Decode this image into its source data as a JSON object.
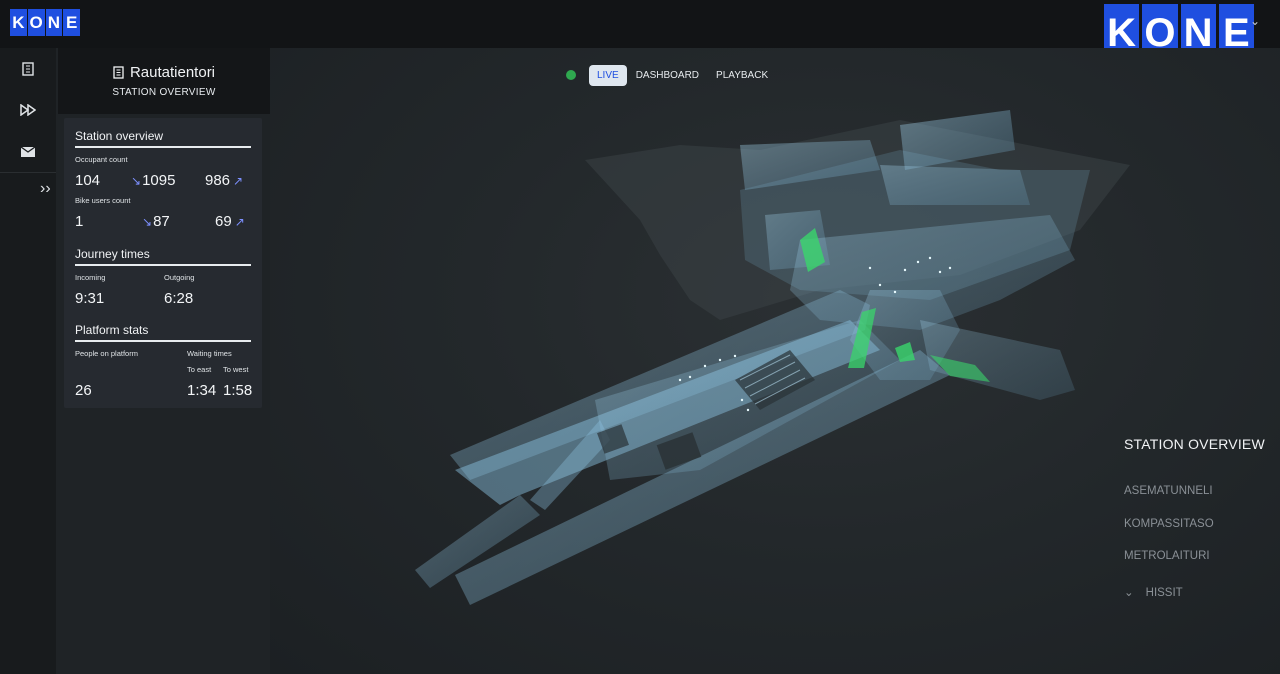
{
  "brand": {
    "logo_letters": [
      "K",
      "O",
      "N",
      "E"
    ]
  },
  "station": {
    "name": "Rautatientori",
    "subtitle": "STATION OVERVIEW"
  },
  "modes": {
    "live": "LIVE",
    "dashboard": "DASHBOARD",
    "playback": "PLAYBACK",
    "live_color": "#2fa84f"
  },
  "overview": {
    "title": "Station overview",
    "occupant_label": "Occupant count",
    "occupant_current": "104",
    "occupant_in": "1095",
    "occupant_out": "986",
    "bike_label": "Bike users count",
    "bike_current": "1",
    "bike_in": "87",
    "bike_out": "69"
  },
  "journey": {
    "title": "Journey times",
    "incoming_label": "Incoming",
    "incoming": "9:31",
    "outgoing_label": "Outgoing",
    "outgoing": "6:28"
  },
  "platform": {
    "title": "Platform stats",
    "people_label": "People on platform",
    "people": "26",
    "waiting_label": "Waiting times",
    "east_label": "To east",
    "east": "1:34",
    "west_label": "To west",
    "west": "1:58"
  },
  "levels": {
    "title": "STATION OVERVIEW",
    "items": [
      "ASEMATUNNELI",
      "KOMPASSITASO",
      "METROLAITURI",
      "HISSIT"
    ]
  },
  "colors": {
    "brand": "#1f4fe0",
    "accent_arrow": "#7d90ff",
    "model": "#8fc7e6",
    "highlight": "#3ad66b"
  }
}
